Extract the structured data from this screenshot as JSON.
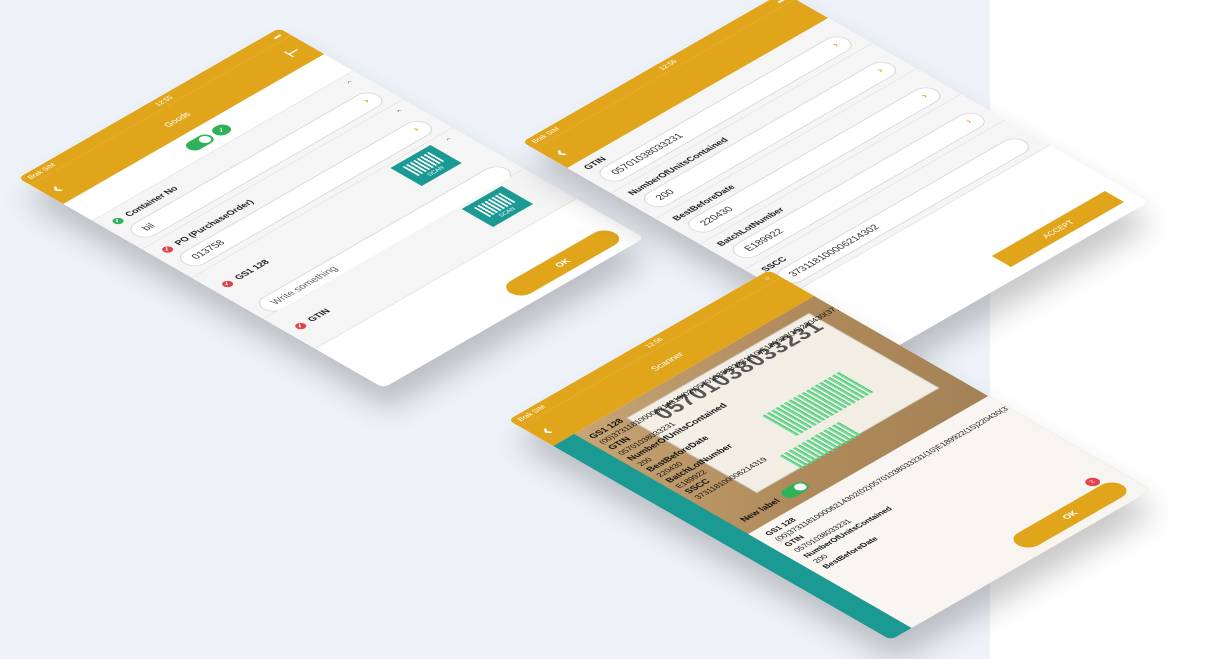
{
  "phone1": {
    "status_carrier": "Brak SIM",
    "status_time": "12:55",
    "title": "Goods",
    "sections": [
      {
        "label": "Container No",
        "status": "ok",
        "value": "bil"
      },
      {
        "label": "PO (PurchaseOrder)",
        "status": "bad",
        "value": "013758"
      },
      {
        "label": "GS1 128",
        "status": "bad",
        "value": "Write something",
        "scan_label": "SCAN"
      },
      {
        "label": "GTIN",
        "status": "bad",
        "scan_label": "SCAN"
      }
    ],
    "ok_label": "OK"
  },
  "phone2": {
    "status_carrier": "Brak SIM",
    "status_time": "12:56",
    "fields": [
      {
        "label": "GTIN",
        "value": "05701038033231"
      },
      {
        "label": "NumberOfUnitsContained",
        "value": "200"
      },
      {
        "label": "BestBeforeDate",
        "value": "220430"
      },
      {
        "label": "BatchLotNumber",
        "value": "E189922"
      },
      {
        "label": "SSCC",
        "value": "373118100006214302"
      }
    ],
    "accept_label": "ACCEPT"
  },
  "phone3": {
    "status_carrier": "Brak SIM",
    "status_time": "12:56",
    "title": "Scanner",
    "gs1_label": "GS1 128",
    "gs1_raw": "(00)373118100006214319(02)05701038033231(10)E189922(15)220430(37)200",
    "big_number": "05701038033231",
    "gtin_label": "GTIN",
    "gtin_value": "05701038033231",
    "units_label": "NumberOfUnitsContained",
    "units_value": "200",
    "bbd_label": "BestBeforeDate",
    "bbd_value": "220430",
    "batch_label": "BatchLotNumber",
    "batch_value": "E189922",
    "sscc_label": "SSCC",
    "sscc_value": "373118100006214319",
    "new_label": "New label",
    "panel_gs1_label": "GS1 128",
    "panel_gs1_raw": "(00)373118100006214302(02)05701038033231(10)E189922(15)220430(37)200",
    "panel_gtin_label": "GTIN",
    "panel_gtin_value": "05701038033231",
    "panel_units_label": "NumberOfUnitsContained",
    "panel_units_value": "200",
    "panel_bbd_label": "BestBeforeDate",
    "ok_label": "OK",
    "badge_count": "2"
  }
}
